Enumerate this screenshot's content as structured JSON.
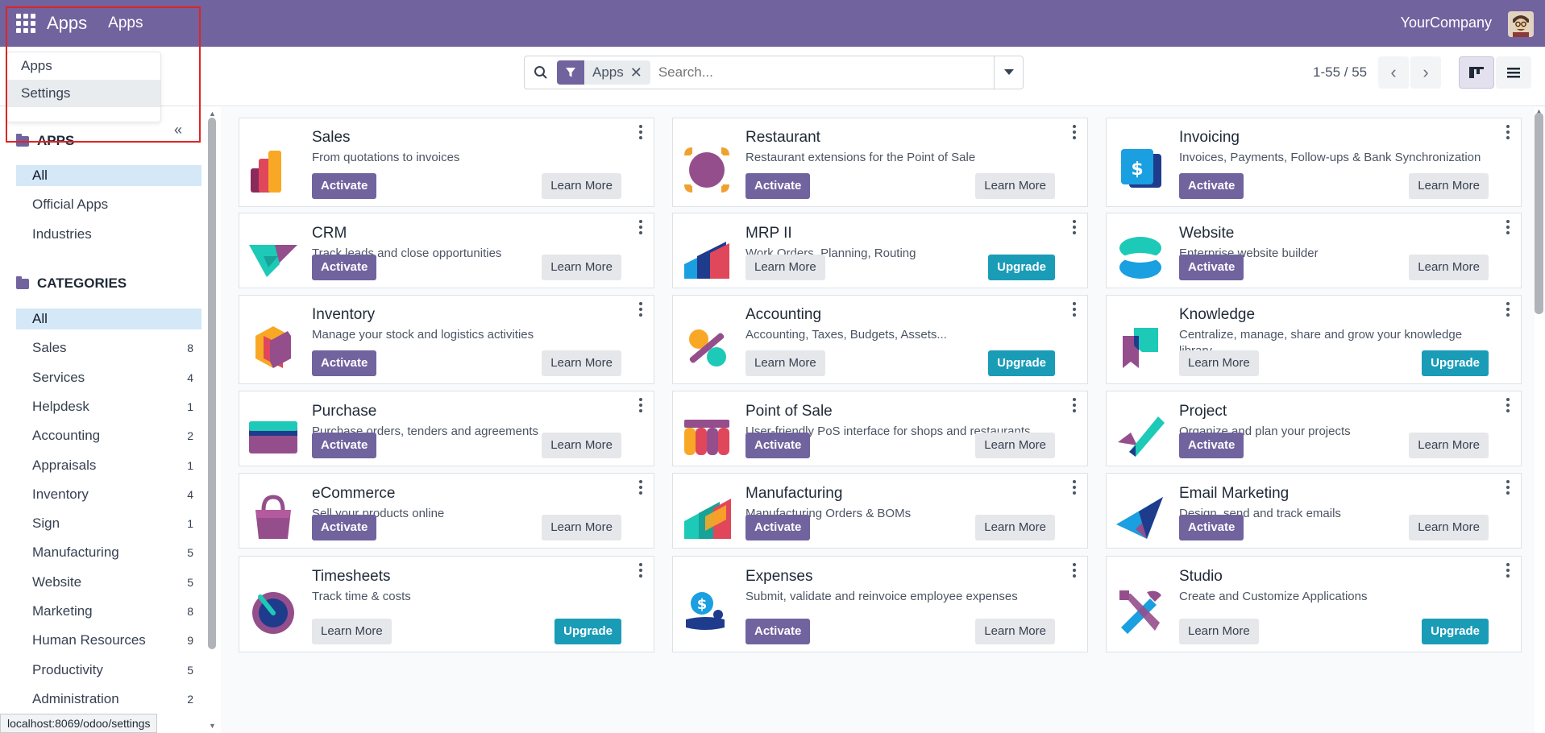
{
  "navbar": {
    "app_name": "Apps",
    "menu_item": "Apps",
    "company": "YourCompany"
  },
  "dropdown": {
    "items": [
      "Apps",
      "Settings"
    ]
  },
  "search": {
    "facet": "Apps",
    "placeholder": "Search..."
  },
  "pager": {
    "value": "1-55 / 55"
  },
  "sidebar": {
    "apps_heading": "APPS",
    "apps_items": [
      "All",
      "Official Apps",
      "Industries"
    ],
    "categories_heading": "CATEGORIES",
    "categories": [
      {
        "label": "All",
        "count": ""
      },
      {
        "label": "Sales",
        "count": "8"
      },
      {
        "label": "Services",
        "count": "4"
      },
      {
        "label": "Helpdesk",
        "count": "1"
      },
      {
        "label": "Accounting",
        "count": "2"
      },
      {
        "label": "Appraisals",
        "count": "1"
      },
      {
        "label": "Inventory",
        "count": "4"
      },
      {
        "label": "Sign",
        "count": "1"
      },
      {
        "label": "Manufacturing",
        "count": "5"
      },
      {
        "label": "Website",
        "count": "5"
      },
      {
        "label": "Marketing",
        "count": "8"
      },
      {
        "label": "Human Resources",
        "count": "9"
      },
      {
        "label": "Productivity",
        "count": "5"
      },
      {
        "label": "Administration",
        "count": "2"
      }
    ]
  },
  "buttons": {
    "activate": "Activate",
    "learn_more": "Learn More",
    "upgrade": "Upgrade"
  },
  "apps": [
    {
      "name": "Sales",
      "desc": "From quotations to invoices",
      "primary": "activate",
      "icon": "sales-icon"
    },
    {
      "name": "Restaurant",
      "desc": "Restaurant extensions for the Point of Sale",
      "primary": "activate",
      "icon": "restaurant-icon"
    },
    {
      "name": "Invoicing",
      "desc": "Invoices, Payments, Follow-ups & Bank Synchronization",
      "primary": "activate",
      "icon": "invoicing-icon"
    },
    {
      "name": "CRM",
      "desc": "Track leads and close opportunities",
      "primary": "activate",
      "icon": "crm-icon"
    },
    {
      "name": "MRP II",
      "desc": "Work Orders, Planning, Routing",
      "primary": "upgrade",
      "icon": "mrp-icon"
    },
    {
      "name": "Website",
      "desc": "Enterprise website builder",
      "primary": "activate",
      "icon": "website-icon"
    },
    {
      "name": "Inventory",
      "desc": "Manage your stock and logistics activities",
      "primary": "activate",
      "icon": "inventory-icon"
    },
    {
      "name": "Accounting",
      "desc": "Accounting, Taxes, Budgets, Assets...",
      "primary": "upgrade",
      "icon": "accounting-icon"
    },
    {
      "name": "Knowledge",
      "desc": "Centralize, manage, share and grow your knowledge library",
      "primary": "upgrade",
      "icon": "knowledge-icon"
    },
    {
      "name": "Purchase",
      "desc": "Purchase orders, tenders and agreements",
      "primary": "activate",
      "icon": "purchase-icon"
    },
    {
      "name": "Point of Sale",
      "desc": "User-friendly PoS interface for shops and restaurants",
      "primary": "activate",
      "icon": "pos-icon"
    },
    {
      "name": "Project",
      "desc": "Organize and plan your projects",
      "primary": "activate",
      "icon": "project-icon"
    },
    {
      "name": "eCommerce",
      "desc": "Sell your products online",
      "primary": "activate",
      "icon": "ecommerce-icon"
    },
    {
      "name": "Manufacturing",
      "desc": "Manufacturing Orders & BOMs",
      "primary": "activate",
      "icon": "manufacturing-icon"
    },
    {
      "name": "Email Marketing",
      "desc": "Design, send and track emails",
      "primary": "activate",
      "icon": "email-marketing-icon"
    },
    {
      "name": "Timesheets",
      "desc": "Track time & costs",
      "primary": "upgrade",
      "icon": "timesheets-icon"
    },
    {
      "name": "Expenses",
      "desc": "Submit, validate and reinvoice employee expenses",
      "primary": "activate",
      "icon": "expenses-icon"
    },
    {
      "name": "Studio",
      "desc": "Create and Customize Applications",
      "primary": "upgrade",
      "icon": "studio-icon"
    }
  ],
  "status_url": "localhost:8069/odoo/settings",
  "colors": {
    "brand": "#71639e",
    "upgrade": "#1a9cb7",
    "selected": "#d4e8f7"
  }
}
